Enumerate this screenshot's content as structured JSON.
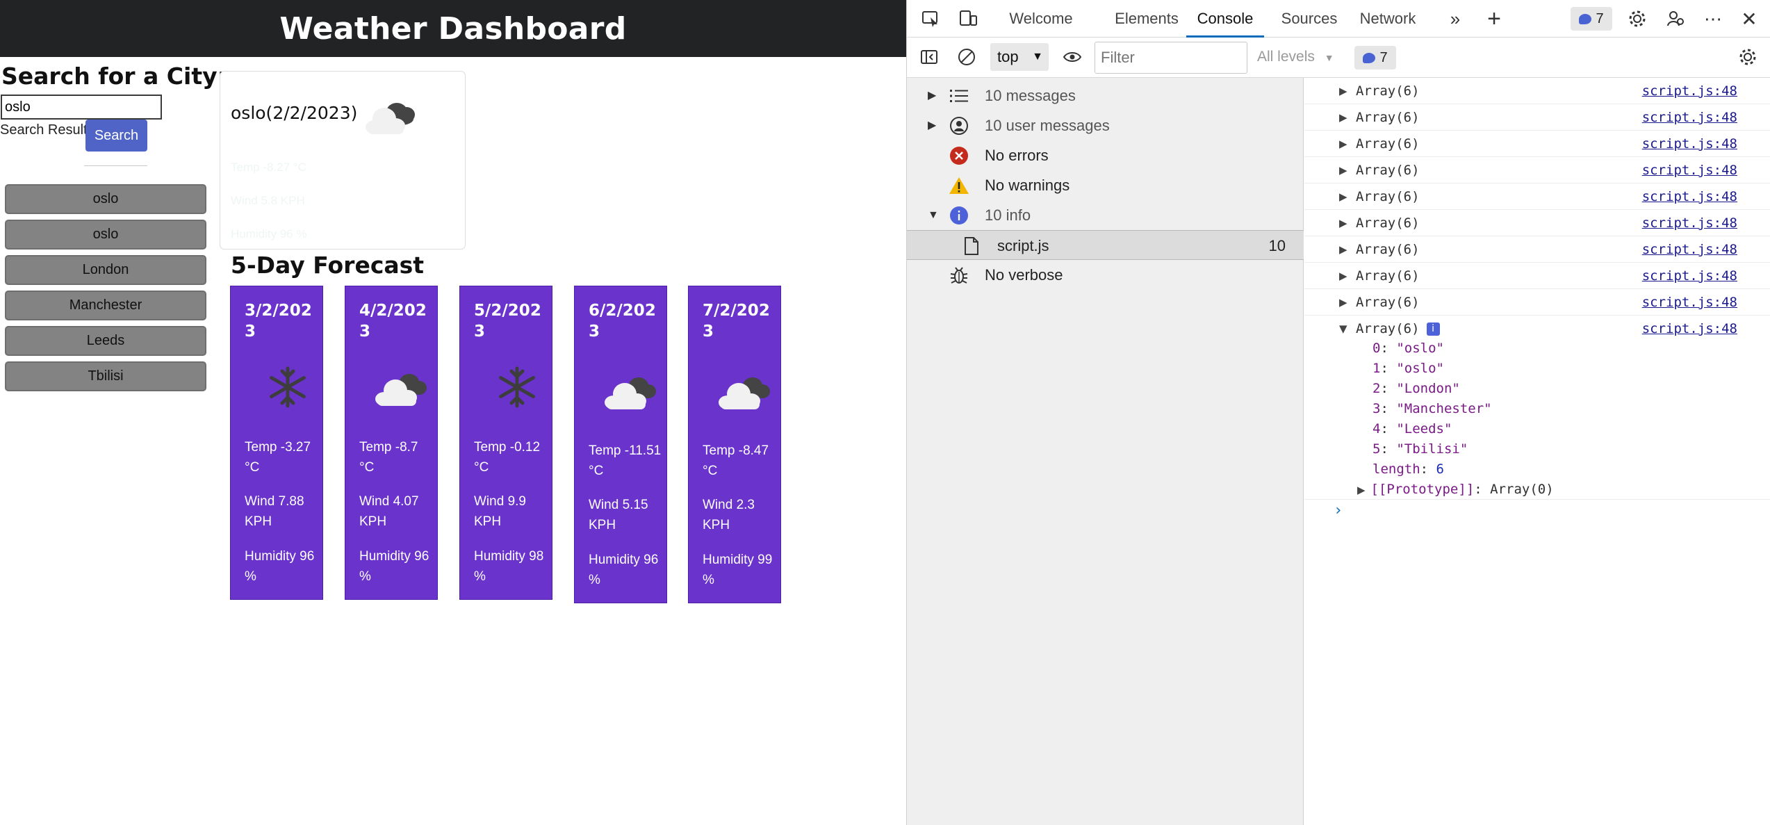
{
  "app": {
    "title": "Weather Dashboard",
    "search_heading": "Search for a City:",
    "search_value": "oslo",
    "search_results_label": "Search Results",
    "search_button": "Search",
    "history": [
      "oslo",
      "oslo",
      "London",
      "Manchester",
      "Leeds",
      "Tbilisi"
    ],
    "current": {
      "city_date": "oslo(2/2/2023)",
      "icon": "cloud-icon",
      "faint_lines": [
        "Temp -8.27 °C",
        "Wind 5.8 KPH",
        "Humidity 96 %"
      ]
    },
    "forecast_heading": "5-Day Forecast",
    "forecast": [
      {
        "date": "3/2/2023",
        "icon": "snowflake-icon",
        "temp": "Temp -3.27 °C",
        "wind": "Wind 7.88 KPH",
        "humidity": "Humidity 96 %"
      },
      {
        "date": "4/2/2023",
        "icon": "cloud-icon",
        "temp": "Temp -8.7 °C",
        "wind": "Wind 4.07 KPH",
        "humidity": "Humidity 96 %"
      },
      {
        "date": "5/2/2023",
        "icon": "snowflake-icon",
        "temp": "Temp -0.12 °C",
        "wind": "Wind 9.9 KPH",
        "humidity": "Humidity 98 %"
      },
      {
        "date": "6/2/2023",
        "icon": "cloud-icon",
        "temp": "Temp -11.51 °C",
        "wind": "Wind 5.15 KPH",
        "humidity": "Humidity 96 %"
      },
      {
        "date": "7/2/2023",
        "icon": "cloud-icon",
        "temp": "Temp -8.47 °C",
        "wind": "Wind 2.3 KPH",
        "humidity": "Humidity 99 %"
      }
    ]
  },
  "devtools": {
    "tabs": [
      "Welcome",
      "Elements",
      "Console",
      "Sources",
      "Network"
    ],
    "active_tab": "Console",
    "issues_count": "7",
    "context": "top",
    "filter_placeholder": "Filter",
    "levels": "All levels",
    "toolbar_issues_count": "7",
    "sidebar": [
      {
        "label": "10 messages",
        "icon": "list-icon"
      },
      {
        "label": "10 user messages",
        "icon": "user-icon"
      },
      {
        "label": "No errors",
        "icon": "error-icon"
      },
      {
        "label": "No warnings",
        "icon": "warning-icon"
      },
      {
        "label": "10 info",
        "icon": "info-icon"
      },
      {
        "label": "script.js",
        "icon": "file-icon",
        "count": "10"
      },
      {
        "label": "No verbose",
        "icon": "bug-icon"
      }
    ],
    "logs": [
      {
        "text": "Array(6)",
        "source": "script.js:48"
      },
      {
        "text": "Array(6)",
        "source": "script.js:48"
      },
      {
        "text": "Array(6)",
        "source": "script.js:48"
      },
      {
        "text": "Array(6)",
        "source": "script.js:48"
      },
      {
        "text": "Array(6)",
        "source": "script.js:48"
      },
      {
        "text": "Array(6)",
        "source": "script.js:48"
      },
      {
        "text": "Array(6)",
        "source": "script.js:48"
      },
      {
        "text": "Array(6)",
        "source": "script.js:48"
      },
      {
        "text": "Array(6)",
        "source": "script.js:48"
      },
      {
        "text": "Array(6)",
        "source": "script.js:48"
      }
    ],
    "expanded": {
      "items": [
        {
          "key": "0",
          "value": "\"oslo\""
        },
        {
          "key": "1",
          "value": "\"oslo\""
        },
        {
          "key": "2",
          "value": "\"London\""
        },
        {
          "key": "3",
          "value": "\"Manchester\""
        },
        {
          "key": "4",
          "value": "\"Leeds\""
        },
        {
          "key": "5",
          "value": "\"Tbilisi\""
        }
      ],
      "length_key": "length",
      "length_value": "6",
      "prototype_key": "[[Prototype]]",
      "prototype_value": "Array(0)"
    },
    "colors": {
      "accent": "#0f6cbd",
      "card": "#6a33cc",
      "button": "#4f64c6"
    }
  }
}
